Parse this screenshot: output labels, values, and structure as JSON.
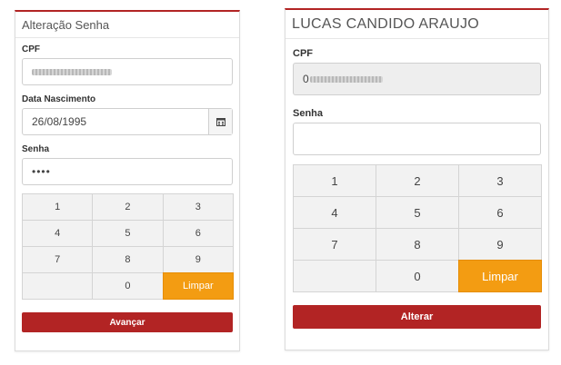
{
  "left_form": {
    "title": "Alteração Senha",
    "cpf_label": "CPF",
    "birth_label": "Data Nascimento",
    "birth_value": "26/08/1995",
    "password_label": "Senha",
    "password_value": "••••",
    "keypad": [
      "1",
      "2",
      "3",
      "4",
      "5",
      "6",
      "7",
      "8",
      "9",
      "",
      "0",
      "Limpar"
    ],
    "submit_label": "Avançar"
  },
  "right_form": {
    "title": "LUCAS CANDIDO ARAUJO",
    "cpf_label": "CPF",
    "cpf_prefix": "0",
    "password_label": "Senha",
    "keypad": [
      "1",
      "2",
      "3",
      "4",
      "5",
      "6",
      "7",
      "8",
      "9",
      "",
      "0",
      "Limpar"
    ],
    "submit_label": "Alterar"
  },
  "colors": {
    "brand_red": "#b22424",
    "clear_orange": "#f39c12"
  },
  "icons": {
    "calendar": "calendar-icon"
  }
}
